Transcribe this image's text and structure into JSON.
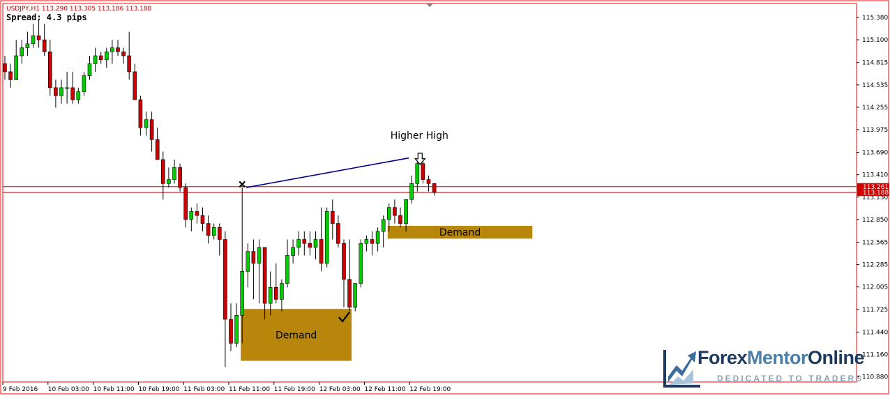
{
  "header": {
    "info": "USDJPY,H1  113.290 113.305 113.186 113.188",
    "spread": "Spread: 4.3 pips"
  },
  "logo": {
    "name_part1": "Forex",
    "name_part2": "Mentor",
    "name_part3": "Online",
    "tagline": "DEDICATED TO TRADERS"
  },
  "colors": {
    "frame": "#ff0000",
    "bull": "#00cc00",
    "bear": "#cc0000",
    "zone": "#b8860b",
    "trendline": "#00008b",
    "price_line": "#cc0000",
    "text": "#000000"
  },
  "chart_data": {
    "type": "candlestick",
    "symbol": "USDJPY",
    "timeframe": "H1",
    "ylim": [
      110.85,
      115.45
    ],
    "y_ticks": [
      "115.380",
      "115.100",
      "114.815",
      "114.535",
      "114.255",
      "113.975",
      "113.690",
      "113.410",
      "113.130",
      "112.850",
      "112.565",
      "112.285",
      "112.005",
      "111.725",
      "111.440",
      "111.160",
      "110.880"
    ],
    "current_prices": [
      "113.261",
      "113.188"
    ],
    "x_labels": [
      "9 Feb 2016",
      "10 Feb 03:00",
      "10 Feb 11:00",
      "10 Feb 19:00",
      "11 Feb 03:00",
      "11 Feb 11:00",
      "11 Feb 19:00",
      "12 Feb 03:00",
      "12 Feb 11:00",
      "12 Feb 19:00"
    ],
    "x_label_index": [
      0,
      8,
      16,
      24,
      32,
      40,
      48,
      56,
      64,
      72
    ],
    "candles": [
      [
        114.8,
        114.9,
        114.6,
        114.7
      ],
      [
        114.7,
        114.8,
        114.5,
        114.6
      ],
      [
        114.6,
        115.1,
        114.6,
        114.9
      ],
      [
        114.9,
        115.1,
        114.8,
        115.0
      ],
      [
        115.0,
        115.2,
        114.9,
        115.05
      ],
      [
        115.05,
        115.3,
        115.0,
        115.15
      ],
      [
        115.15,
        115.35,
        115.0,
        115.1
      ],
      [
        115.1,
        115.3,
        114.9,
        114.95
      ],
      [
        114.95,
        115.1,
        114.4,
        114.5
      ],
      [
        114.5,
        114.6,
        114.25,
        114.4
      ],
      [
        114.4,
        114.6,
        114.3,
        114.5
      ],
      [
        114.5,
        114.7,
        114.3,
        114.5
      ],
      [
        114.5,
        114.7,
        114.3,
        114.35
      ],
      [
        114.35,
        114.5,
        114.3,
        114.45
      ],
      [
        114.45,
        114.7,
        114.4,
        114.65
      ],
      [
        114.65,
        114.9,
        114.6,
        114.8
      ],
      [
        114.8,
        115.0,
        114.7,
        114.9
      ],
      [
        114.9,
        114.95,
        114.8,
        114.85
      ],
      [
        114.85,
        115.0,
        114.75,
        114.95
      ],
      [
        114.95,
        115.1,
        114.8,
        115.0
      ],
      [
        115.0,
        115.1,
        114.9,
        114.95
      ],
      [
        114.95,
        115.0,
        114.8,
        114.9
      ],
      [
        114.9,
        115.2,
        114.6,
        114.7
      ],
      [
        114.7,
        114.8,
        114.4,
        114.35
      ],
      [
        114.35,
        114.4,
        113.9,
        114.0
      ],
      [
        114.0,
        114.2,
        113.9,
        114.1
      ],
      [
        114.1,
        114.2,
        113.7,
        113.85
      ],
      [
        113.85,
        114.0,
        113.6,
        113.6
      ],
      [
        113.6,
        113.7,
        113.1,
        113.3
      ],
      [
        113.3,
        113.5,
        113.25,
        113.35
      ],
      [
        113.35,
        113.6,
        113.3,
        113.5
      ],
      [
        113.5,
        113.55,
        113.2,
        113.25
      ],
      [
        113.25,
        113.3,
        112.75,
        112.85
      ],
      [
        112.85,
        113.0,
        112.7,
        112.95
      ],
      [
        112.95,
        113.05,
        112.8,
        112.9
      ],
      [
        112.9,
        113.0,
        112.7,
        112.8
      ],
      [
        112.8,
        112.9,
        112.55,
        112.65
      ],
      [
        112.65,
        112.8,
        112.6,
        112.75
      ],
      [
        112.75,
        112.8,
        112.4,
        112.6
      ],
      [
        112.6,
        112.7,
        111.0,
        111.6
      ],
      [
        111.6,
        111.8,
        111.2,
        111.3
      ],
      [
        111.3,
        111.8,
        111.25,
        111.65
      ],
      [
        111.65,
        113.25,
        111.3,
        112.2
      ],
      [
        112.2,
        112.55,
        112.0,
        112.45
      ],
      [
        112.45,
        112.6,
        111.85,
        112.3
      ],
      [
        112.3,
        112.6,
        111.8,
        112.5
      ],
      [
        112.5,
        112.5,
        111.6,
        111.8
      ],
      [
        111.8,
        112.2,
        111.65,
        112.0
      ],
      [
        112.0,
        112.3,
        111.8,
        111.85
      ],
      [
        111.85,
        112.1,
        111.7,
        112.05
      ],
      [
        112.05,
        112.6,
        112.0,
        112.4
      ],
      [
        112.4,
        112.6,
        112.3,
        112.5
      ],
      [
        112.5,
        112.7,
        112.4,
        112.6
      ],
      [
        112.6,
        112.7,
        112.4,
        112.55
      ],
      [
        112.55,
        112.7,
        112.4,
        112.5
      ],
      [
        112.5,
        112.7,
        112.35,
        112.6
      ],
      [
        112.6,
        113.0,
        112.2,
        112.3
      ],
      [
        112.3,
        113.0,
        112.25,
        112.95
      ],
      [
        112.95,
        113.1,
        112.6,
        112.8
      ],
      [
        112.8,
        112.9,
        112.5,
        112.55
      ],
      [
        112.55,
        112.6,
        111.75,
        112.1
      ],
      [
        112.1,
        112.6,
        111.7,
        111.75
      ],
      [
        111.75,
        112.0,
        111.7,
        112.05
      ],
      [
        112.05,
        112.6,
        112.0,
        112.55
      ],
      [
        112.55,
        112.65,
        112.45,
        112.6
      ],
      [
        112.6,
        112.7,
        112.4,
        112.55
      ],
      [
        112.55,
        112.75,
        112.45,
        112.7
      ],
      [
        112.7,
        112.9,
        112.5,
        112.85
      ],
      [
        112.85,
        113.05,
        112.7,
        113.0
      ],
      [
        113.0,
        113.1,
        112.8,
        112.9
      ],
      [
        112.9,
        113.0,
        112.75,
        112.8
      ],
      [
        112.8,
        113.1,
        112.7,
        113.1
      ],
      [
        113.1,
        113.4,
        113.05,
        113.3
      ],
      [
        113.3,
        113.6,
        113.2,
        113.55
      ],
      [
        113.55,
        113.6,
        113.3,
        113.35
      ],
      [
        113.35,
        113.4,
        113.2,
        113.3
      ],
      [
        113.3,
        113.3,
        113.15,
        113.19
      ]
    ],
    "demand_zones": [
      {
        "label": "Demand",
        "start_index": 42,
        "end_index": 61,
        "low": 111.08,
        "high": 111.73
      },
      {
        "label": "Demand",
        "start_index": 68,
        "end_index": 93,
        "low": 112.61,
        "high": 112.77
      }
    ],
    "price_lines": [
      113.261,
      113.188
    ],
    "trendline": {
      "from_index": 42,
      "from_price": 113.25,
      "to_index": 71,
      "to_price": 113.62
    },
    "annotations": [
      {
        "text": "Higher High",
        "index": 73,
        "price": 113.86
      },
      {
        "marker": "cross",
        "index": 42,
        "price": 113.29
      },
      {
        "marker": "check",
        "index": 60,
        "price": 111.6
      },
      {
        "marker": "down-arrow",
        "index": 73,
        "price": 113.68
      }
    ]
  }
}
